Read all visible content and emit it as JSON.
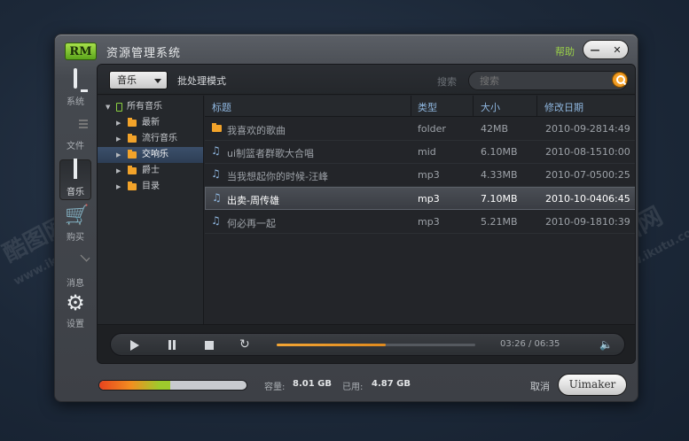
{
  "watermark": {
    "brand": "酷图网",
    "url": "www.ikutu.com"
  },
  "window": {
    "logo": "RM",
    "title": "资源管理系统",
    "help": "帮助",
    "minimize": "—",
    "close": "✕"
  },
  "nav": [
    {
      "label": "系统",
      "icon": "monitor-icon"
    },
    {
      "label": "文件",
      "icon": "document-icon"
    },
    {
      "label": "音乐",
      "icon": "music-icon",
      "active": true
    },
    {
      "label": "购买",
      "icon": "cart-icon"
    },
    {
      "label": "消息",
      "icon": "mail-icon"
    },
    {
      "label": "设置",
      "icon": "gear-icon"
    }
  ],
  "toolbar": {
    "category": "音乐",
    "batch_mode": "批处理模式",
    "search_label": "搜索",
    "search_placeholder": "搜索"
  },
  "tree": {
    "root": "所有音乐",
    "items": [
      "最新",
      "流行音乐",
      "交响乐",
      "爵士",
      "目录"
    ],
    "selected": "交响乐"
  },
  "table": {
    "columns": [
      "标题",
      "类型",
      "大小",
      "修改日期"
    ],
    "rows": [
      {
        "title": "我喜欢的歌曲",
        "type": "folder",
        "size": "42MB",
        "date": "2010-09-28",
        "time": "14:49",
        "icon": "folder-icon"
      },
      {
        "title": "ui制篮者群歌大合唱",
        "type": "mid",
        "size": "6.10MB",
        "date": "2010-08-15",
        "time": "10:00",
        "icon": "music-note-icon"
      },
      {
        "title": "当我想起你的时候-汪峰",
        "type": "mp3",
        "size": "4.33MB",
        "date": "2010-07-05",
        "time": "00:25",
        "icon": "music-note-icon"
      },
      {
        "title": "出卖-周传雄",
        "type": "mp3",
        "size": "7.10MB",
        "date": "2010-10-04",
        "time": "06:45",
        "icon": "music-note-icon",
        "selected": true
      },
      {
        "title": "何必再一起",
        "type": "mp3",
        "size": "5.21MB",
        "date": "2010-09-18",
        "time": "10:39",
        "icon": "music-note-icon"
      }
    ]
  },
  "player": {
    "time": "03:26 / 06:35",
    "progress": 0.55
  },
  "footer": {
    "capacity_label": "容量:",
    "capacity_value": "8.01 GB",
    "used_label": "已用:",
    "used_value": "4.87 GB",
    "usage_fraction": 0.48,
    "cancel": "取消",
    "confirm": "Uimaker"
  }
}
